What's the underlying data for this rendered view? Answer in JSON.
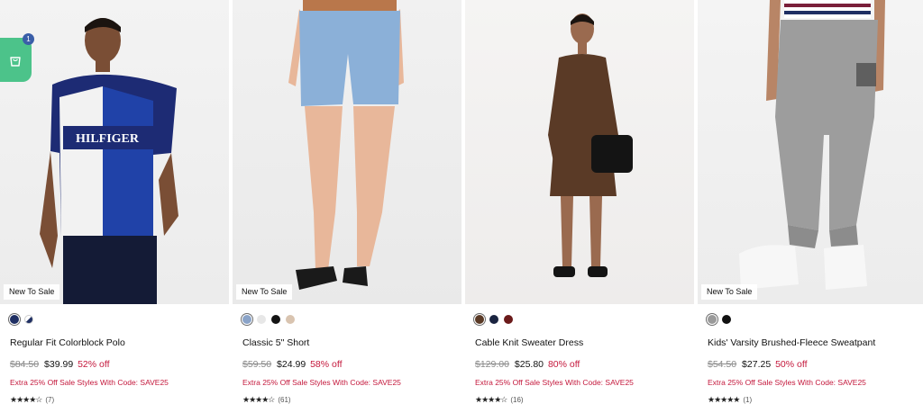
{
  "cart": {
    "count": "1",
    "icon": "shopping-bag-icon"
  },
  "products": [
    {
      "badge": "New To Sale",
      "swatches": [
        "#1f2f63",
        "#ffffff"
      ],
      "name": "Regular Fit Colorblock Polo",
      "was": "$84.50",
      "now": "$39.99",
      "off": "52% off",
      "promo": "Extra 25% Off Sale Styles With Code: SAVE25",
      "stars": "★★★★☆",
      "reviews": "(7)"
    },
    {
      "badge": "New To Sale",
      "swatches": [
        "#8aa3c8",
        "#e7e7e7",
        "#141414",
        "#d9c4b0"
      ],
      "name": "Classic 5\" Short",
      "was": "$59.50",
      "now": "$24.99",
      "off": "58% off",
      "promo": "Extra 25% Off Sale Styles With Code: SAVE25",
      "stars": "★★★★☆",
      "reviews": "(61)"
    },
    {
      "badge": "",
      "swatches": [
        "#5a3a26",
        "#1a2440",
        "#6b1a1a"
      ],
      "name": "Cable Knit Sweater Dress",
      "was": "$129.00",
      "now": "$25.80",
      "off": "80% off",
      "promo": "Extra 25% Off Sale Styles With Code: SAVE25",
      "stars": "★★★★☆",
      "reviews": "(16)"
    },
    {
      "badge": "New To Sale",
      "swatches": [
        "#9a9a9a",
        "#111111"
      ],
      "name": "Kids' Varsity Brushed-Fleece Sweatpant",
      "was": "$54.50",
      "now": "$27.25",
      "off": "50% off",
      "promo": "Extra 25% Off Sale Styles With Code: SAVE25",
      "stars": "★★★★★",
      "reviews": "(1)"
    }
  ],
  "colors": {
    "sale_red": "#c4183c",
    "cart_green": "#4cc38a",
    "cart_badge": "#3a5ea8"
  }
}
